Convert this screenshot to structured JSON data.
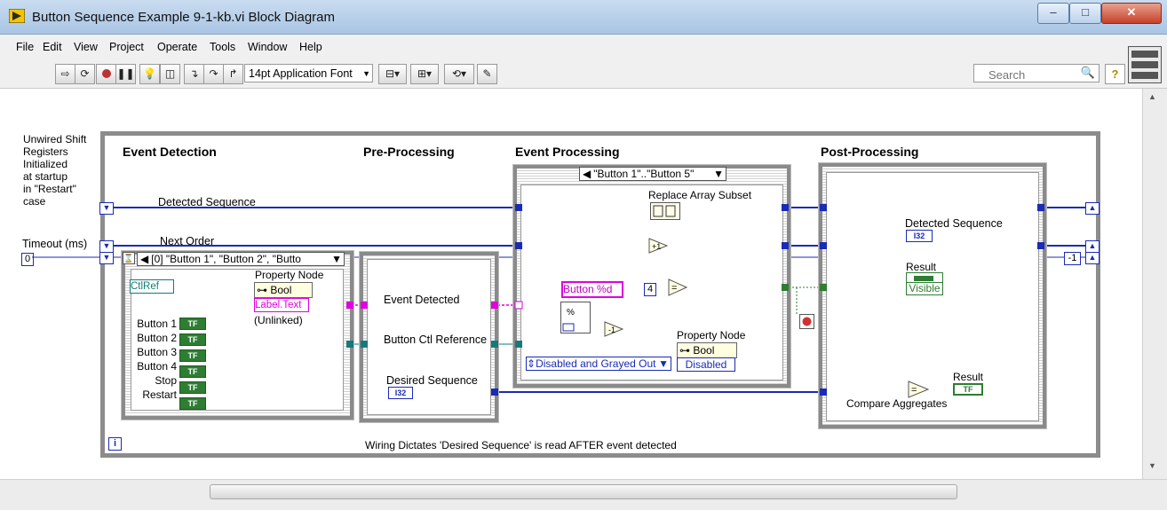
{
  "window": {
    "title": "Button Sequence Example 9-1-kb.vi Block Diagram",
    "buttons": {
      "minimize": "–",
      "maximize": "□",
      "close": "✕"
    }
  },
  "menu": [
    "File",
    "Edit",
    "View",
    "Project",
    "Operate",
    "Tools",
    "Window",
    "Help"
  ],
  "toolbar": {
    "font": "14pt Application Font",
    "search_placeholder": "Search",
    "help": "?"
  },
  "diagram": {
    "comment_left": [
      "Unwired Shift",
      "Registers",
      "Initialized",
      "at startup",
      "in \"Restart\"",
      "case"
    ],
    "timeout_label": "Timeout (ms)",
    "timeout_value": "0",
    "frames": {
      "event_detection": "Event Detection",
      "pre_processing": "Pre-Processing",
      "event_processing": "Event Processing",
      "post_processing": "Post-Processing"
    },
    "wires": {
      "detected_sequence": "Detected Sequence",
      "next_order": "Next Order",
      "event_detected": "Event Detected",
      "button_ctl_reference": "Button Ctl Reference",
      "desired_sequence": "Desired Sequence"
    },
    "event_selector": "[0] \"Button 1\", \"Button 2\", \"Butto",
    "case_selector": "\"Button 1\"..\"Button 5\"",
    "ctlref": "CtlRef",
    "property_node": "Property Node",
    "bool_label": "Bool",
    "label_text": "Label.Text",
    "unlinked": "(Unlinked)",
    "buttons": [
      "Button 1",
      "Button 2",
      "Button 3",
      "Button 4",
      "Stop",
      "Restart"
    ],
    "bool_const": "TF",
    "format_string": "Button %d",
    "replace_array_subset": "Replace Array Subset",
    "const_four": "4",
    "disabled_enum": "Disabled and Grayed Out",
    "disabled_prop": "Disabled",
    "post": {
      "detected_sequence": "Detected Sequence",
      "result": "Result",
      "visible": "Visible",
      "compare_aggregates": "Compare Aggregates",
      "i32": "I32"
    },
    "neg_one": "-1",
    "footer_comment": "Wiring Dictates 'Desired Sequence' is read AFTER event detected",
    "iteration": "i"
  }
}
